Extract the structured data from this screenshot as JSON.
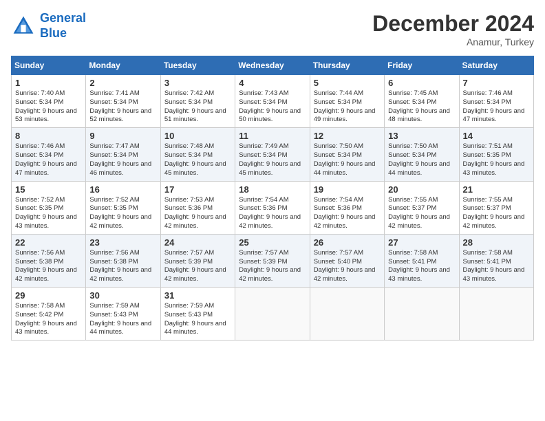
{
  "header": {
    "logo_line1": "General",
    "logo_line2": "Blue",
    "month": "December 2024",
    "location": "Anamur, Turkey"
  },
  "weekdays": [
    "Sunday",
    "Monday",
    "Tuesday",
    "Wednesday",
    "Thursday",
    "Friday",
    "Saturday"
  ],
  "weeks": [
    [
      {
        "day": "1",
        "sunrise": "7:40 AM",
        "sunset": "5:34 PM",
        "daylight": "9 hours and 53 minutes."
      },
      {
        "day": "2",
        "sunrise": "7:41 AM",
        "sunset": "5:34 PM",
        "daylight": "9 hours and 52 minutes."
      },
      {
        "day": "3",
        "sunrise": "7:42 AM",
        "sunset": "5:34 PM",
        "daylight": "9 hours and 51 minutes."
      },
      {
        "day": "4",
        "sunrise": "7:43 AM",
        "sunset": "5:34 PM",
        "daylight": "9 hours and 50 minutes."
      },
      {
        "day": "5",
        "sunrise": "7:44 AM",
        "sunset": "5:34 PM",
        "daylight": "9 hours and 49 minutes."
      },
      {
        "day": "6",
        "sunrise": "7:45 AM",
        "sunset": "5:34 PM",
        "daylight": "9 hours and 48 minutes."
      },
      {
        "day": "7",
        "sunrise": "7:46 AM",
        "sunset": "5:34 PM",
        "daylight": "9 hours and 47 minutes."
      }
    ],
    [
      {
        "day": "8",
        "sunrise": "7:46 AM",
        "sunset": "5:34 PM",
        "daylight": "9 hours and 47 minutes."
      },
      {
        "day": "9",
        "sunrise": "7:47 AM",
        "sunset": "5:34 PM",
        "daylight": "9 hours and 46 minutes."
      },
      {
        "day": "10",
        "sunrise": "7:48 AM",
        "sunset": "5:34 PM",
        "daylight": "9 hours and 45 minutes."
      },
      {
        "day": "11",
        "sunrise": "7:49 AM",
        "sunset": "5:34 PM",
        "daylight": "9 hours and 45 minutes."
      },
      {
        "day": "12",
        "sunrise": "7:50 AM",
        "sunset": "5:34 PM",
        "daylight": "9 hours and 44 minutes."
      },
      {
        "day": "13",
        "sunrise": "7:50 AM",
        "sunset": "5:34 PM",
        "daylight": "9 hours and 44 minutes."
      },
      {
        "day": "14",
        "sunrise": "7:51 AM",
        "sunset": "5:35 PM",
        "daylight": "9 hours and 43 minutes."
      }
    ],
    [
      {
        "day": "15",
        "sunrise": "7:52 AM",
        "sunset": "5:35 PM",
        "daylight": "9 hours and 43 minutes."
      },
      {
        "day": "16",
        "sunrise": "7:52 AM",
        "sunset": "5:35 PM",
        "daylight": "9 hours and 42 minutes."
      },
      {
        "day": "17",
        "sunrise": "7:53 AM",
        "sunset": "5:36 PM",
        "daylight": "9 hours and 42 minutes."
      },
      {
        "day": "18",
        "sunrise": "7:54 AM",
        "sunset": "5:36 PM",
        "daylight": "9 hours and 42 minutes."
      },
      {
        "day": "19",
        "sunrise": "7:54 AM",
        "sunset": "5:36 PM",
        "daylight": "9 hours and 42 minutes."
      },
      {
        "day": "20",
        "sunrise": "7:55 AM",
        "sunset": "5:37 PM",
        "daylight": "9 hours and 42 minutes."
      },
      {
        "day": "21",
        "sunrise": "7:55 AM",
        "sunset": "5:37 PM",
        "daylight": "9 hours and 42 minutes."
      }
    ],
    [
      {
        "day": "22",
        "sunrise": "7:56 AM",
        "sunset": "5:38 PM",
        "daylight": "9 hours and 42 minutes."
      },
      {
        "day": "23",
        "sunrise": "7:56 AM",
        "sunset": "5:38 PM",
        "daylight": "9 hours and 42 minutes."
      },
      {
        "day": "24",
        "sunrise": "7:57 AM",
        "sunset": "5:39 PM",
        "daylight": "9 hours and 42 minutes."
      },
      {
        "day": "25",
        "sunrise": "7:57 AM",
        "sunset": "5:39 PM",
        "daylight": "9 hours and 42 minutes."
      },
      {
        "day": "26",
        "sunrise": "7:57 AM",
        "sunset": "5:40 PM",
        "daylight": "9 hours and 42 minutes."
      },
      {
        "day": "27",
        "sunrise": "7:58 AM",
        "sunset": "5:41 PM",
        "daylight": "9 hours and 43 minutes."
      },
      {
        "day": "28",
        "sunrise": "7:58 AM",
        "sunset": "5:41 PM",
        "daylight": "9 hours and 43 minutes."
      }
    ],
    [
      {
        "day": "29",
        "sunrise": "7:58 AM",
        "sunset": "5:42 PM",
        "daylight": "9 hours and 43 minutes."
      },
      {
        "day": "30",
        "sunrise": "7:59 AM",
        "sunset": "5:43 PM",
        "daylight": "9 hours and 44 minutes."
      },
      {
        "day": "31",
        "sunrise": "7:59 AM",
        "sunset": "5:43 PM",
        "daylight": "9 hours and 44 minutes."
      },
      null,
      null,
      null,
      null
    ]
  ]
}
